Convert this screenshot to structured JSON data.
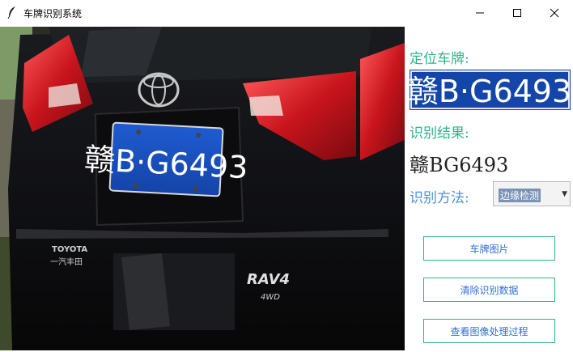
{
  "window": {
    "title": "车牌识别系统",
    "controls": [
      "minimize",
      "maximize",
      "close"
    ]
  },
  "car_image": {
    "plate_text": "赣B·G6493",
    "brand_badge": "TOYOTA",
    "brand_cn": "一汽丰田",
    "model_badge": "RAV4",
    "model_sub": "4WD"
  },
  "panel": {
    "locate_label": "定位车牌:",
    "plate_crop_text": "赣B·G6493",
    "result_label": "识别结果:",
    "result_value": "赣BG6493",
    "method_label": "识别方法:",
    "method_value": "边缘检测"
  },
  "buttons": {
    "car_image": "车牌图片",
    "clear": "清除识别数据",
    "view_process": "查看图像处理过程"
  },
  "colors": {
    "label_green": "#2db38a",
    "method_label": "#4a90d9",
    "button_border": "#2db38a",
    "button_text": "#2f6fd6",
    "plate_blue": "#1346a8"
  }
}
